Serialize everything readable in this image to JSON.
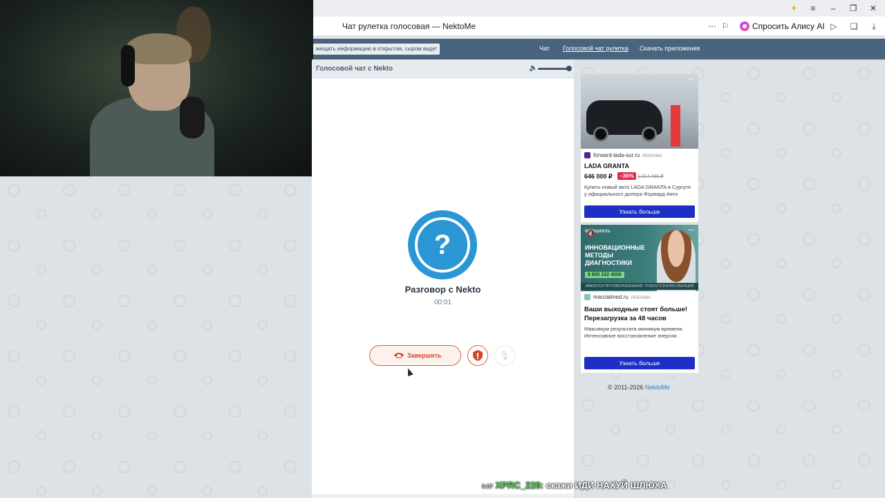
{
  "browser": {
    "tab_title": "Чат рулетка голосовая — NektoMe",
    "alisa_label": "Спросить Алису AI",
    "window_controls": [
      "minimize-icon",
      "maximize-icon",
      "close-icon"
    ],
    "toolbar_icons": [
      "more-icon",
      "bookmark-icon",
      "play-icon",
      "extensions-icon",
      "download-icon"
    ]
  },
  "site": {
    "notice": "мещать информацию в открытом, сыром виде!",
    "nav": [
      "Чат",
      "Голосовой чат рулетка",
      "Скачать приложения"
    ],
    "active_nav": "Голосовой чат рулетка"
  },
  "chat": {
    "header_title": "Голосовой чат с Nekto",
    "volume_level": 1.0,
    "avatar_glyph": "?",
    "title": "Разговор с Nekto",
    "timer": "00:01",
    "end_button": "Завершить",
    "colors": {
      "accent": "#2a97d4",
      "danger": "#e05a3a"
    }
  },
  "ads": [
    {
      "domain": "forward-lada-sur.ru",
      "tag": "РЕКЛАМА",
      "title": "LADA GRANTA",
      "price": "646 000 ₽",
      "discount": "−36%",
      "old_price": "1 014 400 ₽",
      "description": "Купить новый авто LADA GRANTA в Сургуте у официального дилера Форвард-Авто",
      "button": "Узнать больше"
    },
    {
      "banner_logo": "марциаль",
      "banner_headline": "ИННОВАЦИОННЫЕ МЕТОДЫ ДИАГНОСТИКИ",
      "banner_phone": "8 800 222 4008",
      "banner_disclaimer": "ИМЕЮТСЯ ПРОТИВОПОКАЗАНИЯ. ТРЕБУЕТСЯ КОНСУЛЬТАЦИЯ СПЕЦИАЛИСТА",
      "domain": "marcialmed.ru",
      "tag": "РЕКЛАМА",
      "title": "Ваши выходные стоят больше! Перезагрузка за 48 часов",
      "description": "Максимум результата минимум времени. Интенсивное восстановление энергии.",
      "button": "Узнать больше"
    }
  ],
  "footer": {
    "copyright": "© 2011-2026",
    "link": "NektoMe"
  },
  "stream_overlay": {
    "time": "0:07",
    "user": "XPRC_228:",
    "message": "скажи ИДИ НАХУЙ ШЛЮХА"
  }
}
